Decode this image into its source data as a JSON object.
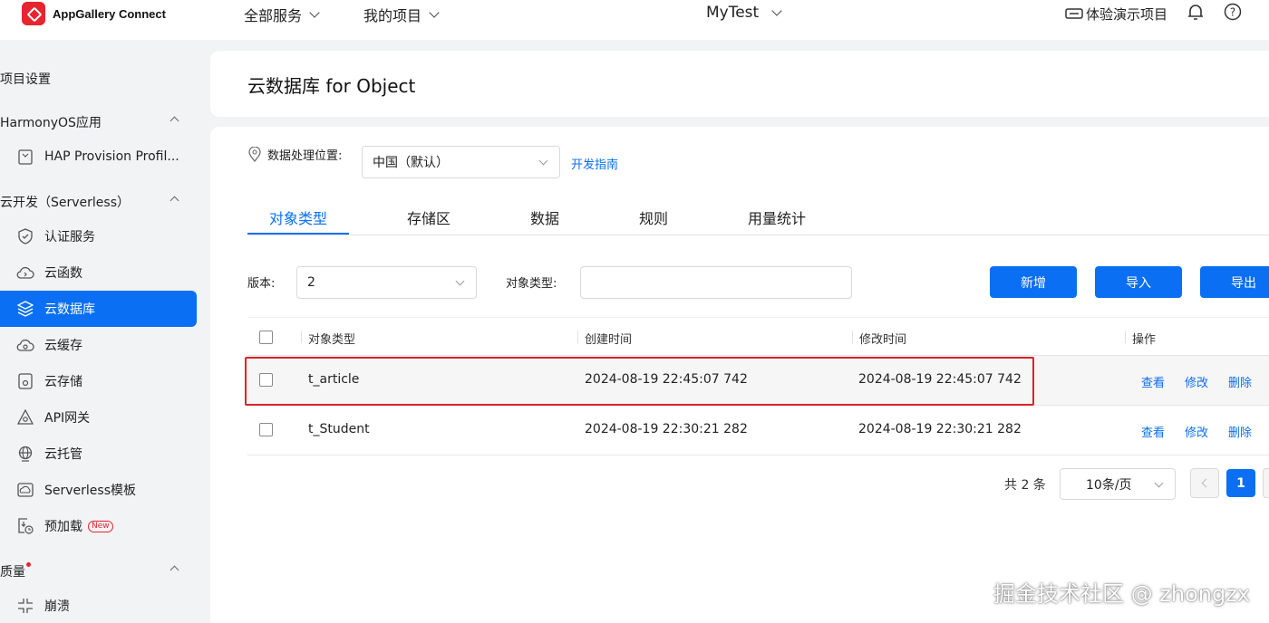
{
  "topbar": {
    "brand": "AppGallery Connect",
    "nav_all_services": "全部服务",
    "nav_my_projects": "我的项目",
    "project": "MyTest",
    "demo": "体验演示项目"
  },
  "sidebar": {
    "project_settings": "项目设置",
    "groups": [
      {
        "label": "HarmonyOS应用"
      },
      {
        "label": "云开发（Serverless）"
      },
      {
        "label": "质量"
      }
    ],
    "items": [
      {
        "label": "HAP Provision Profil...",
        "icon": "file-icon"
      },
      {
        "label": "认证服务",
        "icon": "shield-check-icon"
      },
      {
        "label": "云函数",
        "icon": "cloud-function-icon"
      },
      {
        "label": "云数据库",
        "icon": "database-layers-icon"
      },
      {
        "label": "云缓存",
        "icon": "cache-icon"
      },
      {
        "label": "云存储",
        "icon": "storage-icon"
      },
      {
        "label": "API网关",
        "icon": "api-gateway-icon"
      },
      {
        "label": "云托管",
        "icon": "globe-icon"
      },
      {
        "label": "Serverless模板",
        "icon": "template-icon"
      },
      {
        "label": "预加载",
        "icon": "preload-icon",
        "badge": "New"
      },
      {
        "label": "崩溃",
        "icon": "crash-icon"
      }
    ],
    "active_color": "#0a6ff2"
  },
  "page": {
    "title": "云数据库 for Object",
    "location_label": "数据处理位置:",
    "location_value": "中国（默认）",
    "dev_guide": "开发指南",
    "tabs": [
      "对象类型",
      "存储区",
      "数据",
      "规则",
      "用量统计"
    ],
    "filter": {
      "version_label": "版本:",
      "version_value": "2",
      "type_label": "对象类型:",
      "type_value": ""
    },
    "buttons": {
      "add": "新增",
      "import": "导入",
      "export": "导出"
    },
    "table": {
      "headers": [
        "对象类型",
        "创建时间",
        "修改时间",
        "操作"
      ],
      "rows": [
        {
          "type": "t_article",
          "created": "2024-08-19 22:45:07 742",
          "modified": "2024-08-19 22:45:07 742"
        },
        {
          "type": "t_Student",
          "created": "2024-08-19 22:30:21 282",
          "modified": "2024-08-19 22:30:21 282"
        }
      ],
      "actions": [
        "查看",
        "修改",
        "删除"
      ]
    },
    "pagination": {
      "total": "共 2 条",
      "page_size": "10条/页",
      "current": "1"
    }
  },
  "watermark": "掘金技术社区 @ zhongzx",
  "colors": {
    "primary": "#0a6ff2",
    "highlight": "#d9232d"
  }
}
